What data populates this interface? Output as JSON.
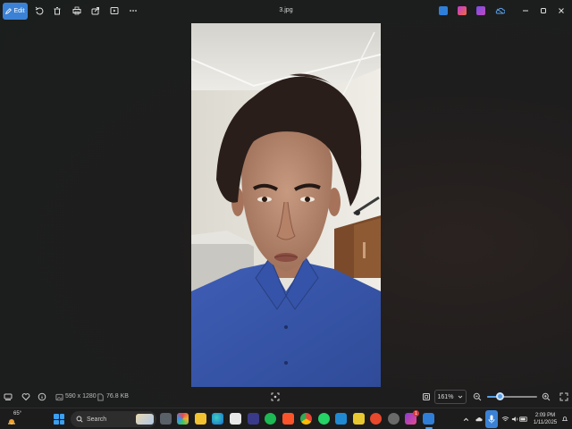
{
  "toolbar": {
    "edit_label": "Edit",
    "file_title": "3.jpg",
    "icons": [
      "edit-icon",
      "rotate-icon",
      "delete-icon",
      "print-icon",
      "share-icon",
      "slideshow-icon",
      "more-icon"
    ]
  },
  "status": {
    "dimensions": "590 x 1280",
    "file_size": "76.8 KB",
    "zoom": "161%",
    "zoom_fraction": 0.25
  },
  "taskbar": {
    "weather_temp": "65°",
    "search_placeholder": "Search",
    "notification_badge": "1",
    "time": "2:09 PM",
    "date": "1/11/2025"
  },
  "colors": {
    "accent": "#3b82d6",
    "background": "#1e1d1d",
    "shirt": "#3a57a8",
    "wall": "#e4e2dc"
  }
}
